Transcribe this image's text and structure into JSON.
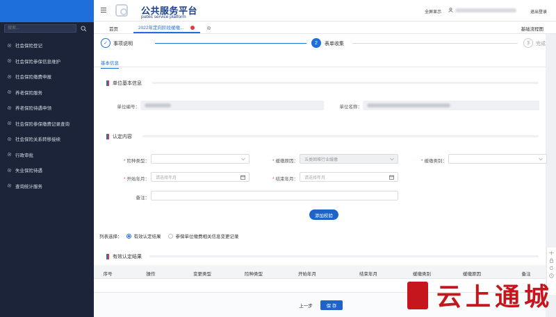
{
  "sidebar": {
    "search_placeholder": "搜索...",
    "items": [
      {
        "label": "社会保险登记"
      },
      {
        "label": "社会保险参保信息维护"
      },
      {
        "label": "社会保险缴费申报"
      },
      {
        "label": "养老保险服务"
      },
      {
        "label": "养老保险待遇申领"
      },
      {
        "label": "社会保险参保缴费记录查询"
      },
      {
        "label": "社会保险关系转移接续"
      },
      {
        "label": "行政审批"
      },
      {
        "label": "失业保险待遇"
      },
      {
        "label": "查询统计服务"
      }
    ]
  },
  "header": {
    "brand_title": "公共服务平台",
    "brand_subtitle": "public service platform",
    "fullscreen": "全屏显示",
    "logout": "退出登录"
  },
  "tabs": {
    "home": "首页",
    "active": "2022年定向阶段缓缴...",
    "flow": "基础流程图"
  },
  "steps": [
    {
      "num": "✓",
      "label": "事项说明",
      "state": "done"
    },
    {
      "num": "2",
      "label": "表单收集",
      "state": "active"
    },
    {
      "num": "3",
      "label": "完成",
      "state": "pending"
    }
  ],
  "subtab": "基本信息",
  "unit_section": {
    "title": "单位基本信息",
    "unit_code_label": "单位编号：",
    "unit_name_label": "单位名称："
  },
  "confirm_section": {
    "title": "认定内容",
    "insurance_type_label": "险种类型：",
    "defer_reason_label": "缓缴原因：",
    "defer_reason_value": "五类困难行业缓缴",
    "defer_category_label": "缓缴类别：",
    "start_label": "开始年月：",
    "start_placeholder": "请选择年月",
    "end_label": "结束年月：",
    "end_placeholder": "请选择年月",
    "remark_label": "备注：",
    "verify_button": "添加校验"
  },
  "list_select": {
    "label": "列表选择：",
    "option1": "有效认定结果",
    "option2": "参保单位缴费相关信息变更记录"
  },
  "result_section": {
    "title": "有效认定结果",
    "columns": [
      "序号",
      "操作",
      "变更类型",
      "险种类型",
      "开始年月",
      "结束年月",
      "缓缴类别",
      "缓缴原因",
      "备注"
    ]
  },
  "footer": {
    "prev": "上一步",
    "save": "保 存"
  },
  "watermark": {
    "text": "云上通城"
  },
  "colors": {
    "sidebar_bg": "#1b2438",
    "primary": "#1e6fd9",
    "brand": "#1b3f8a",
    "seal_red": "#c4161c"
  }
}
